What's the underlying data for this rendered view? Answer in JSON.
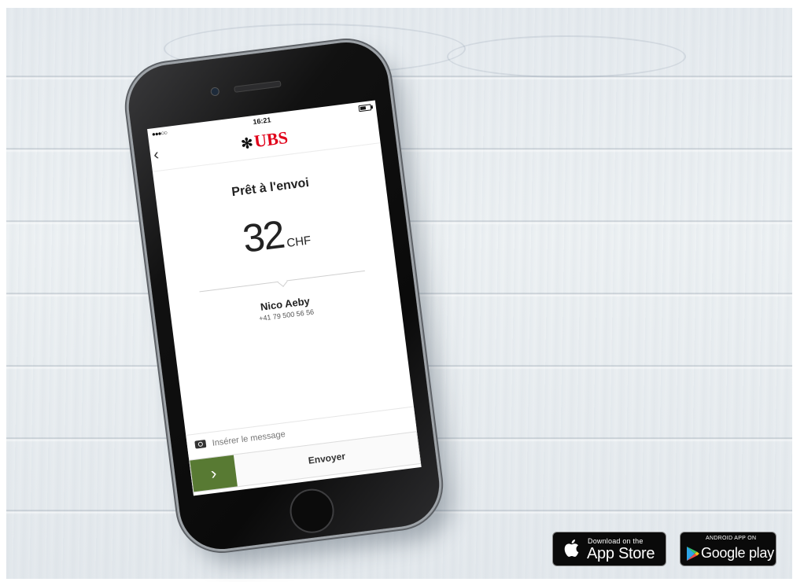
{
  "phone": {
    "status_bar": {
      "signal": "●●●○○",
      "time": "16:21",
      "battery_level": 0.6
    },
    "nav": {
      "back_icon": "‹",
      "brand_mark": "✻",
      "brand_name": "UBS"
    },
    "transfer": {
      "status": "Prêt à l'envoi",
      "amount": "32",
      "currency": "CHF"
    },
    "recipient": {
      "name": "Nico Aeby",
      "phone": "+41 79 500 56 56"
    },
    "message": {
      "placeholder": "Insérer le message",
      "icon": "camera-icon"
    },
    "send": {
      "arrow": "›",
      "label": "Envoyer"
    }
  },
  "badges": {
    "apple": {
      "small": "Download on the",
      "big": "App Store"
    },
    "google": {
      "small": "ANDROID APP ON",
      "big": "Google play"
    }
  },
  "colors": {
    "brand_red": "#e1001a",
    "send_green": "#587a33"
  }
}
